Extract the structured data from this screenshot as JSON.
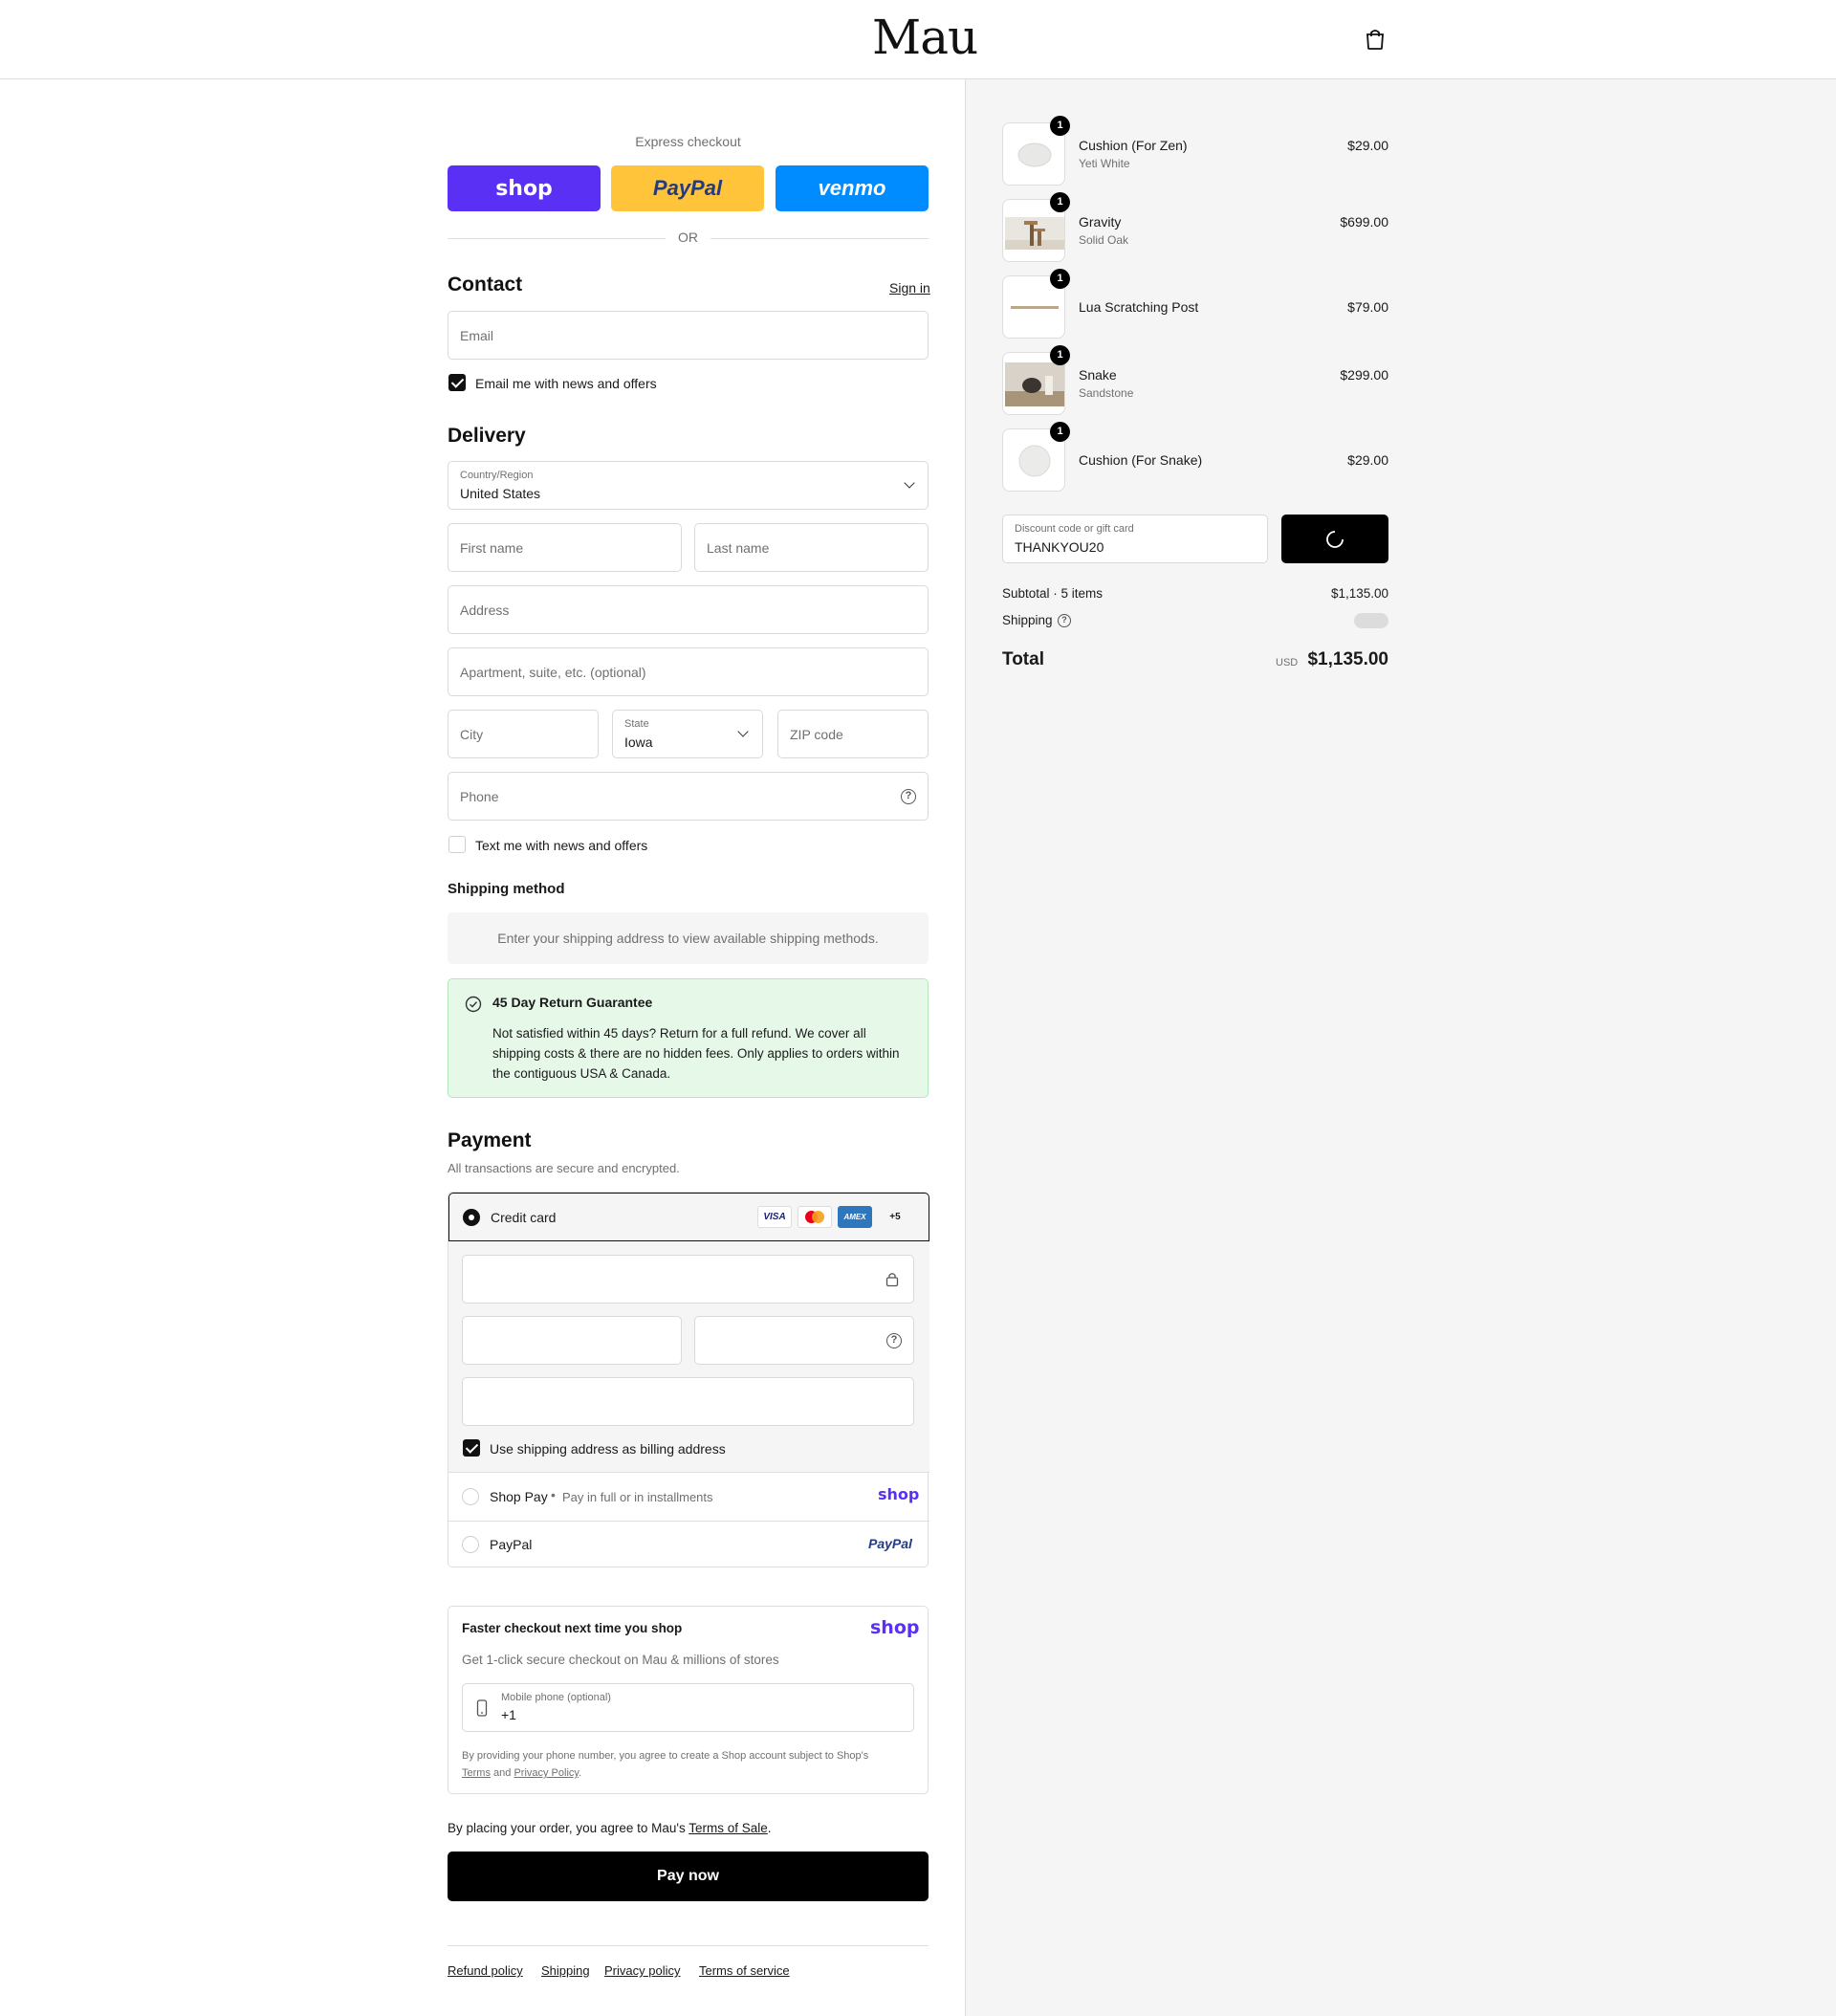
{
  "header": {
    "logo": "Mau",
    "cart_icon": "shopping-bag-icon"
  },
  "express": {
    "label": "Express checkout",
    "buttons": [
      {
        "label": "shop",
        "color": "#5a31f4"
      },
      {
        "label": "PayPal",
        "color": "#ffc439"
      },
      {
        "label": "venmo",
        "color": "#008cff"
      }
    ],
    "or": "OR"
  },
  "contact": {
    "title": "Contact",
    "sign_in": "Sign in",
    "email_placeholder": "Email",
    "news_checkbox": "Email me with news and offers",
    "news_checked": true
  },
  "delivery": {
    "title": "Delivery",
    "country_label": "Country/Region",
    "country_value": "United States",
    "first_name": "First name",
    "last_name": "Last name",
    "address": "Address",
    "apartment": "Apartment, suite, etc. (optional)",
    "city": "City",
    "state_label": "State",
    "state_value": "Iowa",
    "zip": "ZIP code",
    "phone": "Phone",
    "text_checkbox": "Text me with news and offers"
  },
  "shipping_method": {
    "title": "Shipping method",
    "message": "Enter your shipping address to view available shipping methods."
  },
  "guarantee": {
    "title": "45 Day Return Guarantee",
    "line1": "Not satisfied within 45 days? Return for a full refund. We cover all",
    "line2": "shipping costs & there are no hidden fees. Only applies to orders within",
    "line3": "the contiguous USA & Canada.",
    "bg_color": "#e6f9e9"
  },
  "payment": {
    "title": "Payment",
    "subtitle": "All transactions are secure and encrypted.",
    "credit_card": "Credit card",
    "card_badges": [
      "VISA",
      "MC",
      "AMEX",
      "+5"
    ],
    "billing_checkbox": "Use shipping address as billing address",
    "shop_pay": "Shop Pay",
    "shop_pay_sub": "Pay in full or in installments",
    "shop_logo": "shop",
    "paypal": "PayPal",
    "paypal_logo": "PayPal"
  },
  "faster": {
    "title": "Faster checkout next time you shop",
    "logo": "shop",
    "subtitle": "Get 1-click secure checkout on Mau & millions of stores",
    "phone_label": "Mobile phone (optional)",
    "phone_value": "+1",
    "legal_1": "By providing your phone number, you agree to create a Shop account subject to Shop's",
    "terms": "Terms",
    "and": "and",
    "privacy": "Privacy Policy",
    "period": "."
  },
  "agreement": {
    "text": "By placing your order, you agree to Mau's",
    "link": "Terms of Sale",
    "period": "."
  },
  "pay_now": "Pay now",
  "footer": [
    "Refund policy",
    "Shipping",
    "Privacy policy",
    "Terms of service"
  ],
  "order": {
    "items": [
      {
        "name": "Cushion (For Zen)",
        "variant": "Yeti White",
        "price": "$29.00",
        "qty": "1"
      },
      {
        "name": "Gravity",
        "variant": "Solid Oak",
        "price": "$699.00",
        "qty": "1"
      },
      {
        "name": "Lua Scratching Post",
        "variant": "",
        "price": "$79.00",
        "qty": "1"
      },
      {
        "name": "Snake",
        "variant": "Sandstone",
        "price": "$299.00",
        "qty": "1"
      },
      {
        "name": "Cushion (For Snake)",
        "variant": "",
        "price": "$29.00",
        "qty": "1"
      }
    ],
    "discount_label": "Discount code or gift card",
    "discount_value": "THANKYOU20",
    "subtotal_label": "Subtotal · 5 items",
    "subtotal_value": "$1,135.00",
    "shipping_label": "Shipping",
    "total_label": "Total",
    "currency": "USD",
    "total_value": "$1,135.00"
  }
}
